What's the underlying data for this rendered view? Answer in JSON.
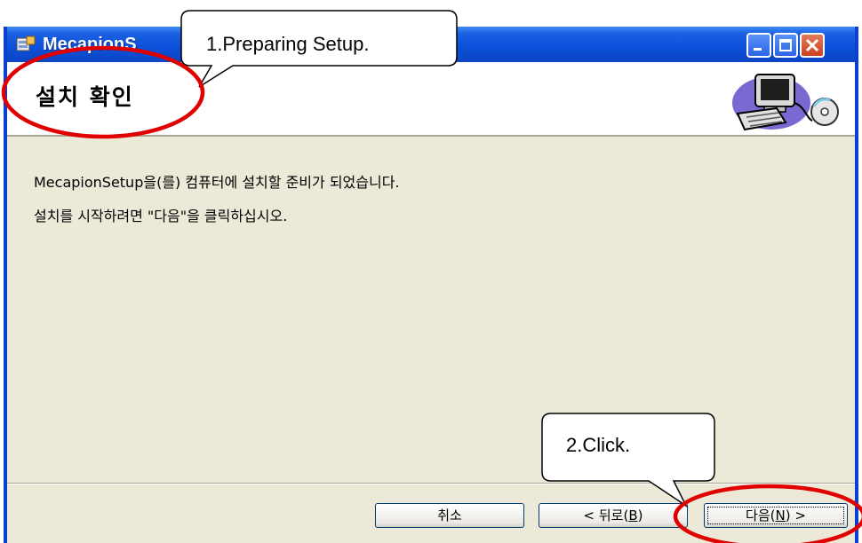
{
  "window": {
    "title": "MecapionS",
    "minimize_icon": "minimize-icon",
    "maximize_icon": "maximize-icon",
    "close_icon": "close-icon"
  },
  "header": {
    "title": "설치 확인",
    "picture_icon": "computer-cd-icon"
  },
  "body": {
    "line1": "MecapionSetup을(를) 컴퓨터에 설치할 준비가 되었습니다.",
    "line2": "설치를 시작하려면 \"다음\"을 클릭하십시오."
  },
  "buttons": {
    "cancel": "취소",
    "back_prefix": "< 뒤로(",
    "back_key": "B",
    "back_suffix": ")",
    "next_prefix": "다음(",
    "next_key": "N",
    "next_suffix": ") >"
  },
  "annotations": {
    "callout1": "1.Preparing Setup.",
    "callout2": "2.Click.",
    "highlight_color": "#e00000"
  },
  "colors": {
    "titlebar": "#0a50d9",
    "dialog_bg": "#ece9d8"
  }
}
